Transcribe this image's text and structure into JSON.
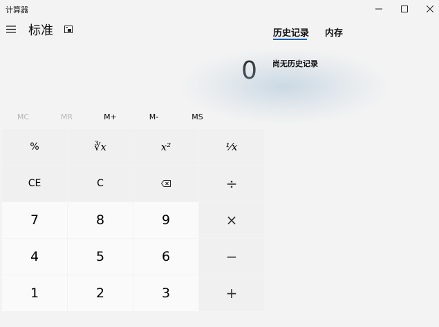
{
  "window": {
    "title": "计算器"
  },
  "header": {
    "mode_title": "标准",
    "menu_icon": "hamburger-menu-icon",
    "keep_on_top_icon": "keep-on-top-icon"
  },
  "display": {
    "value": "0"
  },
  "memory": {
    "buttons": [
      {
        "label": "MC",
        "enabled": false
      },
      {
        "label": "MR",
        "enabled": false
      },
      {
        "label": "M+",
        "enabled": true
      },
      {
        "label": "M-",
        "enabled": true
      },
      {
        "label": "MS",
        "enabled": true
      }
    ]
  },
  "keypad": {
    "rows": [
      [
        "%",
        "∛x",
        "x²",
        "⅟x"
      ],
      [
        "CE",
        "C",
        "⌫",
        "÷"
      ],
      [
        "7",
        "8",
        "9",
        "×"
      ],
      [
        "4",
        "5",
        "6",
        "−"
      ],
      [
        "1",
        "2",
        "3",
        "+"
      ]
    ]
  },
  "history_panel": {
    "tabs": [
      "历史记录",
      "内存"
    ],
    "active_tab": "历史记录",
    "empty_message": "尚无历史记录"
  },
  "colors": {
    "background": "#f3f3f3",
    "number_key": "#fafafa",
    "function_key": "#f0f0f0",
    "accent": "#1a5fb4",
    "disabled_text": "#b5b5b5"
  }
}
